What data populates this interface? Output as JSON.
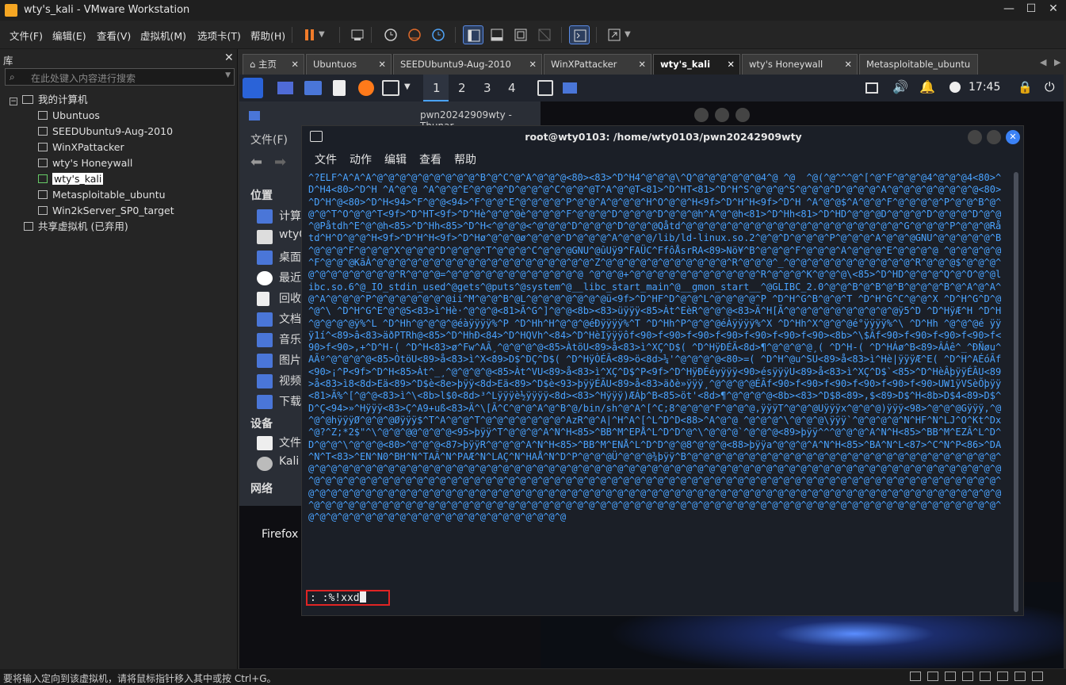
{
  "window": {
    "title": "wty's_kali - VMware Workstation"
  },
  "menubar": [
    "文件(F)",
    "编辑(E)",
    "查看(V)",
    "虚拟机(M)",
    "选项卡(T)",
    "帮助(H)"
  ],
  "library": {
    "header": "库",
    "search_placeholder": "在此处键入内容进行搜索",
    "root": "我的计算机",
    "vms": [
      "Ubuntuos",
      "SEEDUbuntu9-Aug-2010",
      "WinXPattacker",
      "wty's Honeywall",
      "wty's_kali",
      "Metasploitable_ubuntu",
      "Win2kServer_SP0_target"
    ],
    "selected": "wty's_kali",
    "shared": "共享虚拟机 (已弃用)"
  },
  "tabs": [
    {
      "label": "主页",
      "active": false
    },
    {
      "label": "Ubuntuos",
      "active": false
    },
    {
      "label": "SEEDUbuntu9-Aug-2010",
      "active": false
    },
    {
      "label": "WinXPattacker",
      "active": false
    },
    {
      "label": "wty's_kali",
      "active": true
    },
    {
      "label": "wty's Honeywall",
      "active": false
    },
    {
      "label": "Metasploitable_ubuntu",
      "active": false
    }
  ],
  "guest": {
    "workspaces": [
      "1",
      "2",
      "3",
      "4"
    ],
    "clock": "17:45",
    "thunar": {
      "title": "pwn20242909wty - Thunar",
      "menu": "文件(F)",
      "places_header": "位置",
      "places": [
        "计算",
        "wtyC",
        "桌面",
        "最近",
        "回收",
        "文档",
        "音乐",
        "图片",
        "视频",
        "下载"
      ],
      "devices_header": "设备",
      "devices": [
        "文件",
        "Kali"
      ],
      "network_header": "网络",
      "desktop_label": "Firefox"
    },
    "terminal": {
      "title": "root@wty0103: /home/wty0103/pwn20242909wty",
      "menu": [
        "文件",
        "动作",
        "编辑",
        "查看",
        "帮助"
      ],
      "command": ": :%!xxd",
      "content": "^?ELF^A^A^A^@^@^@^@^@^@^@^@^@^B^@^C^@^A^@^@^@<80><83>^D^H4^@^@^@\\^Q^@^@^@^@^@^@4^@ ^@  ^@(^@^^^@^[^@^F^@^@^@4^@^@^@4<80>^D^H4<80>^D^H ^A^@^@ ^A^@^@^E^@^@^@^D^@^@^@^C^@^@^@T^A^@^@T<81>^D^HT<81>^D^H^S^@^@^@^S^@^@^@^D^@^@^@^A^@^@^@^@^@^@^@^@<80>^D^H^@<80>^D^H<94>^F^@^@<94>^F^@^@^E^@^@^@^@^P^@^@^A^@^@^@^H^O^@^@^H<9f>^D^H^H<9f>^D^H ^A^@^@$^A^@^@^F^@^@^@^@^P^@^@^B^@^@^@^T^O^@^@^T<9f>^D^HT<9f>^D^Hè^@^@^@è^@^@^@^F^@^@^@^D^@^@^@^D^@^@^@h^A^@^@h<81>^D^Hh<81>^D^HD^@^@^@D^@^@^@^D^@^@^@^D^@^@^@Påtdh^E^@^@h<85>^D^Hh<85>^D^H<^@^@^@<^@^@^@^D^@^@^@^D^@^@^@Qåtd^@^@^@^@^@^@^@^@^@^@^@^@^@^@^@^@^@^@^@^G^@^@^@^P^@^@^@Råtd^H^O^@^@^H<9f>^D^H^H<9f>^D^Hø^@^@^@ø^@^@^@^D^@^@^@^A^@^@^@/lib/ld-linux.so.2^@^@^D^@^@^@^P^@^@^@^A^@^@^@GNU^@^@^@^@^@^B^@^@^@^F^@^@^@^X^@^@^@^D^@^@^@^T^@^@^@^C^@^@^@GNU^@ûUÿ9^FAÜC^FfôÅsrRA<89>Nö¥^B^@^@^@^F^@^@^@^A^@^@^@^E^@^@^@^@ ^@^@^@^@^@^F^@^@^@KãÀ^@^@^@^@^@^@^@^@^@^@^@^@^@^@^@^@^@^@^@^Z^@^@^@^@^@^@^@^@^@^@^@^R^@^@^@^_^@^@^@^@^@^@^@^@^@^@^@^R^@^@^@$^@^@^@^@^@^@^@^@^@^@^@^R^@^@^@=^@^@^@^@^@^@^@^@^@^@^@^@ ^@^@^@+^@^@^@^@^@^@^@^@^@^@^@^R^@^@^@^K^@^@^@\\<85>^D^HD^@^@^@^Q^@^O^@^@libc.so.6^@_IO_stdin_used^@gets^@puts^@system^@__libc_start_main^@__gmon_start__^@GLIBC_2.0^@^@^B^@^B^@^B^@^@^@^B^@^A^@^A^@^A^@^@^@^P^@^@^@^@^@^@^@ii^M^@^@^B^@L^@^@^@^@^@^@^@ü<9f>^D^HF^D^@^@^L^@^@^@^@^P ^D^H^G^B^@^@^T ^D^H^G^C^@^@^X ^D^H^G^D^@^@^\\ ^D^H^G^E^@^@S<83>ì^Hè·^@^@^@<81>Ã^G^]^@^@<8b><83>üÿÿÿ<85>Àt^EèR^@^@^@<83>Ä^H[Ã^@^@^@^@^@^@^@^@^@^@ÿ5^D ^D^HÿÆ^H ^D^H^@^@^@^@ÿ%^L ^D^Hh^@^@^@^@éàÿÿÿÿ%^P ^D^Hh^H^@^@^@éÐÿÿÿÿ%^T ^D^Hh^P^@^@^@éÀÿÿÿÿ%^X ^D^Hh^X^@^@^@é°ÿÿÿÿ%^\\ ^D^Hh ^@^@^@é ÿÿÿ1í^<89>â<83>äðPTRh@<85>^D^HhÐ<84>^D^HQVh^<84>^D^HèIÿÿÿôf<90>f<90>f<90>f<90>f<90>f<90>f<90><8b>^\\$Ãf<90>f<90>f<90>f<90>f<90>f<90>,+^D^H-( ^D^H<83>ø^Fw^AÃ¸^@^@^@^@<85>ÀtöU<89>å<83>ì^XÇ^D$( ^D^HÿÐÉÃ<8d>¶^@^@^@^@¸( ^D^H-( ^D^HÁø^B<89>ÂÁê^_^ÐÑøu^AÃº^@^@^@^@<85>ÒtöU<89>å<83>ì^X<89>D$^DÇ^D$( ^D^HÿÒÉÃ<89>ö<8d>¼'^@^@^@^@<80>=( ^D^H^@u^SU<89>å<83>ì^Hè|ÿÿÿÆ^E( ^D^H^AÉóÃf<90>¡^P<9f>^D^H<85>Àt^_¸^@^@^@^@<85>Àt^VU<89>å<83>ì^XÇ^D$^P<9f>^D^HÿÐÉéyÿÿÿ<90>ésÿÿÿU<89>å<83>ì^XÇ^D$`<85>^D^HèÂþÿÿÉÃU<89>å<83>ì8<8d>Eä<89>^D$è<8e>þÿÿ<8d>Eä<89>^D$è<93>þÿÿÉÃU<89>å<83>äðè»ÿÿÿ¸^@^@^@^@ÉÃf<90>f<90>f<90>f<90>f<90>f<90>UW1ÿVSèÕþÿÿ<81>Ã%^[^@^@<83>ì^\\<8b>l$0<8d>³^Lÿÿÿè½ÿÿÿÿ<8d><83>^Hÿÿÿ)ÆÁþ^B<85>öt'<8d>¶^@^@^@^@<8b><83>^D$8<89>,$<89>D$^H<8b>D$4<89>D$^D^Ç<94>»^Hÿÿÿ<83>Ç^A9+uß<83>Ä^\\[Ã^C^@^@^A^@^B^@/bin/sh^@^A^[^C;8^@^@^@^F^@^@^@,ÿÿÿT^@^@^@Uÿÿÿx^@^@^@)ÿÿÿ<98>^@^@^@Gÿÿÿ,^@^@^@hÿÿÿØ^@^@^@Øÿÿÿ$^T^A^@^@^T^@^@^@^@^@^@^@^AzR^@^A|^H^A^[^L^D^D<88>^A^@^@ ^@^@^@^\\^@^@^@\\ÿÿÿ`^@^@^@^@^N^HF^N^LJ^O^Kt^Dx^@?^Z;*2$\"^\\^@^@^@@^@^@^@<95>þÿÿ^T^@^@^@^A^N^H<85>^BB^M^EPÅ^L^D^D^@^\\^@^@^@`^@^@^@<89>þÿÿ^^^@^@^@^A^N^H<85>^BB^M^EZÃ^L^D^D^@^@^\\^@^@^@<80>^@^@^@<87>þÿÿR^@^@^@^A^N^H<85>^BB^M^ENÅ^L^D^D^@^@8^@^@^@<88>þÿÿa^@^@^@^A^N^H<85>^BA^N^L<87>^C^N^P<86>^DA^N^T<83>^EN^N0^BH^N^TAÃ^N^PAÆ^N^LAÇ^N^HAÅ^N^D^P^@^@^@Ü^@^@^@¾þÿÿ^B^@^@^@^@^@^@^@^@^@^@^@^@^@^@^@^@^@^@^@^@^@^@^@^@^@^@^@^@^@^@^@^@^@^@^@^@^@^@^@^@^@^@^@^@^@^@^@^@^@^@^@^@^@^@^@^@^@^@^@^@^@^@^@^@^@^@^@^@^@^@^@^@^@^@^@^@^@^@^@^@^@^@^@^@^@^@^@^@^@^@^@^@^@^@^@^@^@^@^@^@^@^@^@^@^@^@^@^@^@^@^@^@^@^@^@^@^@^@^@^@^@^@^@^@^@^@^@^@^@^@^@^@^@^@^@^@^@^@^@^@^@^@^@^@^@^@^@^@^@^@^@^@^@^@^@^@^@^@^@^@^@^@^@^@^@^@^@^@^@^@^@^@^@^@^@^@^@^@^@^@^@^@^@^@^@^@^@^@^@^@^@^@^@^@^@^@^@^@^@^@^@^@^@^@^@^@^@^@^@^@^@^@^@^@^@^@^@^@^@^@^@^@^@^@^@^@^@^@^@^@^@^@^@^@^@^@^@^@^@^@^@^@^@^@^@^@^@^@^@^@^@^@^@^@^@^@^@^@^@^@^@^@^@^@^@^@^@^@^@^@^@^@^@^@^@^@^@^@^@^@^@^@^@^@^@^@^@^@^@^@^@^@"
    }
  },
  "statusbar": "要将输入定向到该虚拟机，请将鼠标指针移入其中或按 Ctrl+G。",
  "colors": {
    "accent": "#2a63d8",
    "term_text": "#4aa3ff",
    "highlight_box": "#e02424"
  }
}
